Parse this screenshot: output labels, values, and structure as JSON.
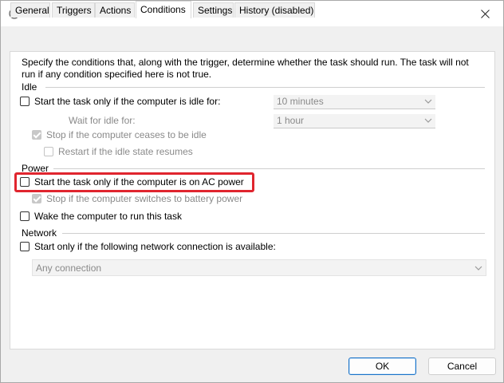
{
  "window": {
    "icon": "clock-icon"
  },
  "tabs": [
    "General",
    "Triggers",
    "Actions",
    "Conditions",
    "Settings",
    "History (disabled)"
  ],
  "active_tab": "Conditions",
  "description": "Specify the conditions that, along with the trigger, determine whether the task should run.  The task will not run  if any condition specified here is not true.",
  "idle": {
    "label": "Idle",
    "start_if_idle": {
      "label": "Start the task only if the computer is idle for:",
      "checked": false,
      "value": "10 minutes"
    },
    "wait_for_idle": {
      "label": "Wait for idle for:",
      "value": "1 hour"
    },
    "stop_if_ceases": {
      "label": "Stop if the computer ceases to be idle",
      "checked": true
    },
    "restart_if_resumes": {
      "label": "Restart if the idle state resumes",
      "checked": false
    }
  },
  "power": {
    "label": "Power",
    "ac_power": {
      "label": "Start the task only if the computer is on AC power",
      "checked": false
    },
    "battery_stop": {
      "label": "Stop if the computer switches to battery power",
      "checked": true
    },
    "wake": {
      "label": "Wake the computer to run this task",
      "checked": false
    }
  },
  "network": {
    "label": "Network",
    "start_if_network": {
      "label": "Start only if the following network connection is available:",
      "checked": false
    },
    "connection": "Any connection"
  },
  "buttons": {
    "ok": "OK",
    "cancel": "Cancel"
  },
  "colors": {
    "highlight": "#e0252e",
    "default_button_border": "#1a73c8"
  }
}
